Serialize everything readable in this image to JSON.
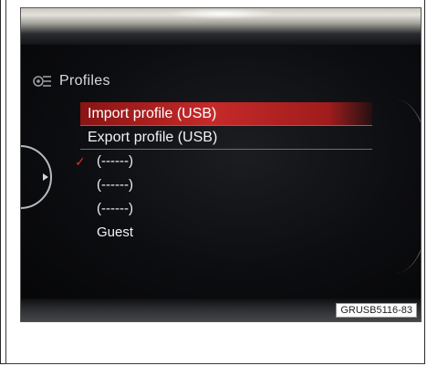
{
  "screen": {
    "title": "Profiles",
    "menu_items": [
      {
        "label": "Import profile (USB)",
        "selected": true
      },
      {
        "label": "Export profile (USB)",
        "selected": false
      },
      {
        "label": "(------)",
        "checked": true
      },
      {
        "label": "(------)"
      },
      {
        "label": "(------)"
      },
      {
        "label": "Guest"
      }
    ],
    "header_icon": "gear-list-icon",
    "check_icon": "checkmark-icon"
  },
  "caption": "GRUSB5116-83",
  "colors": {
    "highlight": "#c62a2a",
    "check": "#d23030",
    "text": "#f2f2f2"
  }
}
